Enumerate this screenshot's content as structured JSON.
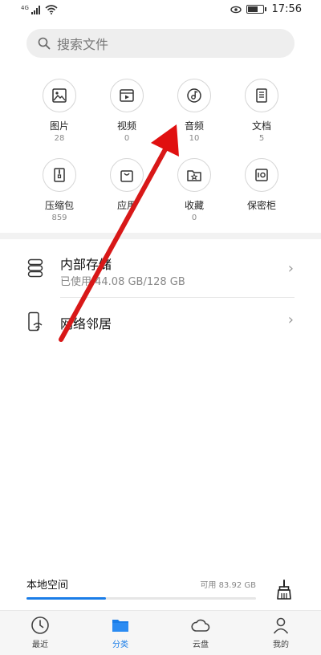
{
  "status_bar": {
    "network_label": "4G",
    "time": "17:56"
  },
  "search": {
    "placeholder": "搜索文件"
  },
  "categories": [
    {
      "name": "图片",
      "count": "28",
      "icon": "image-icon"
    },
    {
      "name": "视频",
      "count": "0",
      "icon": "video-icon"
    },
    {
      "name": "音频",
      "count": "10",
      "icon": "music-icon"
    },
    {
      "name": "文档",
      "count": "5",
      "icon": "document-icon"
    },
    {
      "name": "压缩包",
      "count": "859",
      "icon": "zip-icon"
    },
    {
      "name": "应用",
      "count": "",
      "icon": "shopping-bag-icon"
    },
    {
      "name": "收藏",
      "count": "0",
      "icon": "favorite-folder-icon"
    },
    {
      "name": "保密柜",
      "count": "",
      "icon": "safe-icon"
    }
  ],
  "storage": {
    "internal": {
      "title": "内部存储",
      "usage": "已使用 44.08 GB/128 GB",
      "used_fraction": 0.344
    },
    "network": {
      "title": "网络邻居"
    }
  },
  "local_space": {
    "title": "本地空间",
    "available": "可用 83.92 GB",
    "used_fraction": 0.345
  },
  "tabs": [
    {
      "label": "最近",
      "icon": "clock-icon",
      "active": false
    },
    {
      "label": "分类",
      "icon": "folder-icon",
      "active": true
    },
    {
      "label": "云盘",
      "icon": "cloud-icon",
      "active": false
    },
    {
      "label": "我的",
      "icon": "person-icon",
      "active": false
    }
  ],
  "colors": {
    "accent": "#1a7de8",
    "annotation_arrow": "#e01010"
  }
}
